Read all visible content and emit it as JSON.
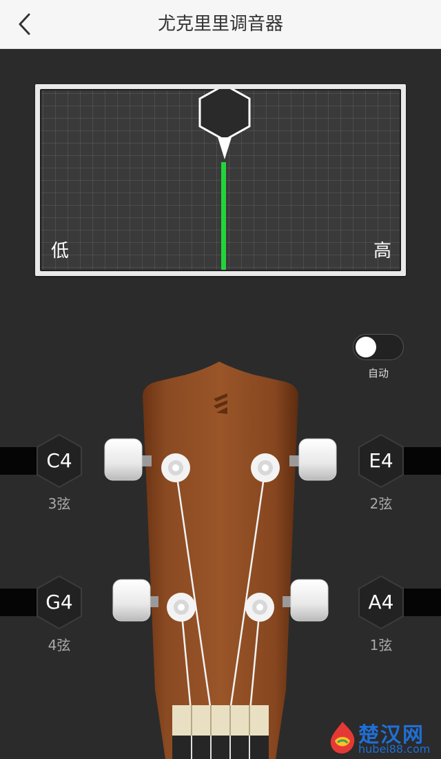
{
  "header": {
    "title": "尤克里里调音器",
    "back_icon": "chevron-left-icon"
  },
  "meter": {
    "low_label": "低",
    "high_label": "高",
    "needle_color": "#22d53a",
    "deviation": 0
  },
  "auto_toggle": {
    "label": "自动",
    "on": false
  },
  "strings": [
    {
      "note": "C4",
      "label": "3弦"
    },
    {
      "note": "E4",
      "label": "2弦"
    },
    {
      "note": "G4",
      "label": "4弦"
    },
    {
      "note": "A4",
      "label": "1弦"
    }
  ],
  "watermark": {
    "text": "楚汉网",
    "url": "hubei88.com"
  }
}
